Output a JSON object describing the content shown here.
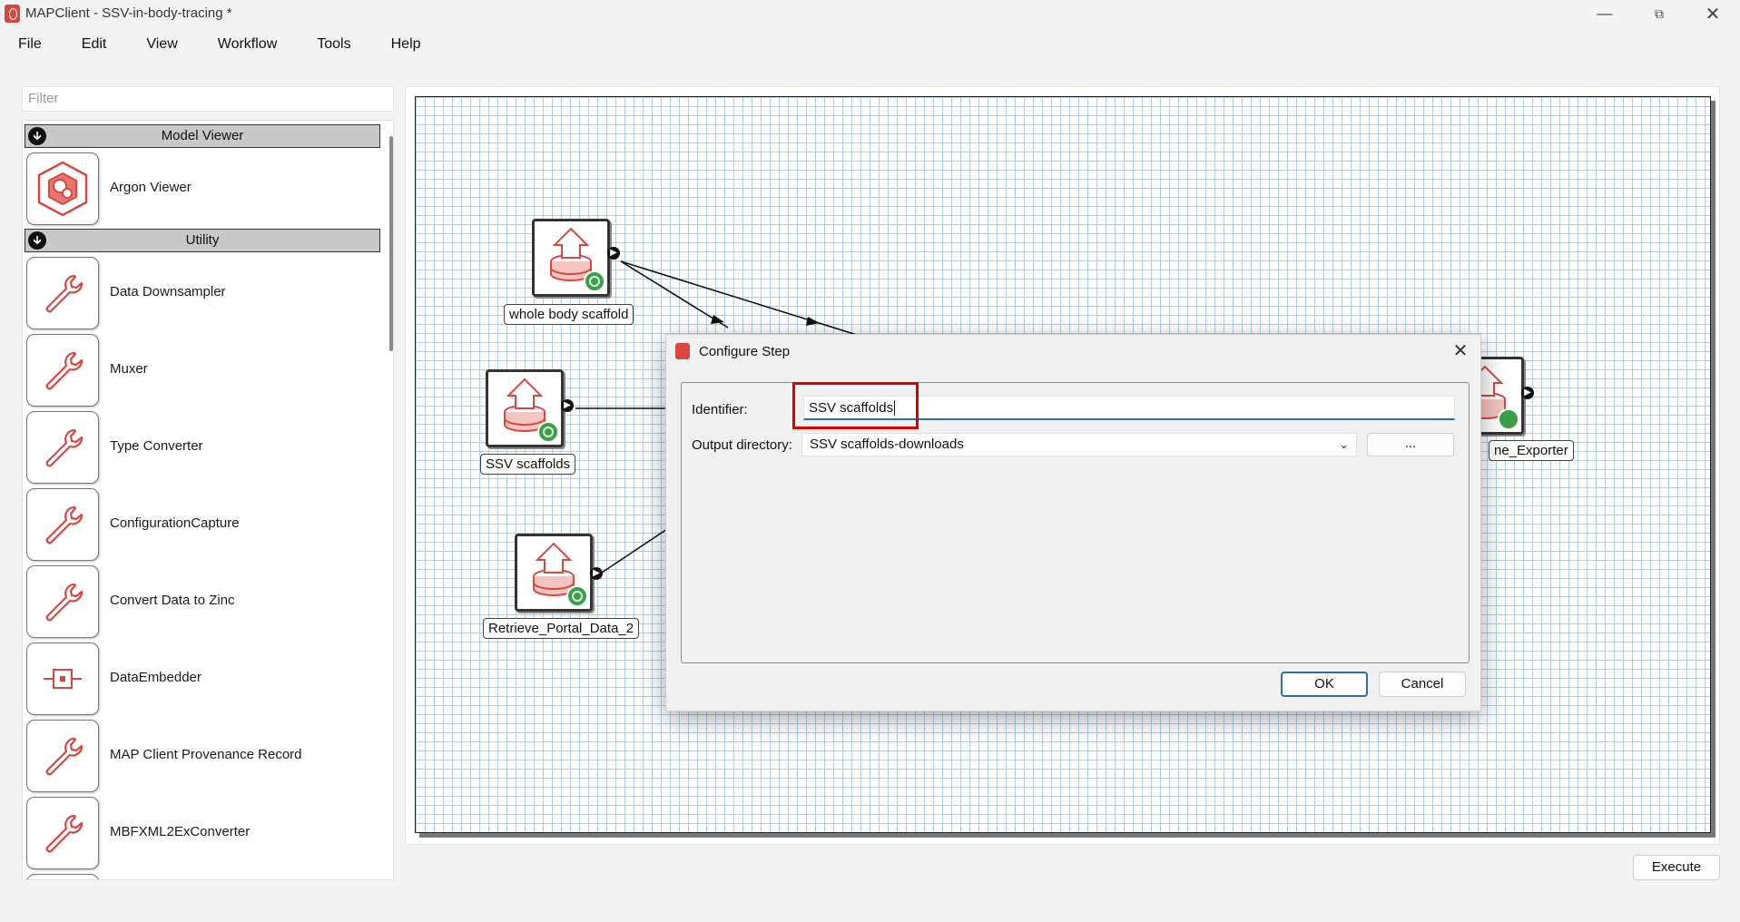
{
  "window": {
    "title": "MAPClient - SSV-in-body-tracing *",
    "minimize_icon": "minimize-icon",
    "maximize_icon": "restore-icon",
    "close_icon": "close-icon"
  },
  "menu": [
    "File",
    "Edit",
    "View",
    "Workflow",
    "Tools",
    "Help"
  ],
  "step_panel": {
    "filter_placeholder": "Filter",
    "categories": [
      {
        "name": "Model Viewer",
        "steps": [
          {
            "label": "Argon Viewer",
            "icon": "argon-viewer-icon"
          }
        ]
      },
      {
        "name": "Utility",
        "steps": [
          {
            "label": "Data Downsampler",
            "icon": "wrench-icon"
          },
          {
            "label": "Muxer",
            "icon": "wrench-icon"
          },
          {
            "label": "Type Converter",
            "icon": "wrench-icon"
          },
          {
            "label": "ConfigurationCapture",
            "icon": "wrench-icon"
          },
          {
            "label": "Convert Data to Zinc",
            "icon": "wrench-icon"
          },
          {
            "label": "DataEmbedder",
            "icon": "embed-icon"
          },
          {
            "label": "MAP Client Provenance Record",
            "icon": "wrench-icon"
          },
          {
            "label": "MBFXML2ExConverter",
            "icon": "wrench-icon"
          }
        ]
      }
    ]
  },
  "workflow": {
    "nodes": [
      {
        "label": "whole body scaffold",
        "icon": "upload-database-icon"
      },
      {
        "label": "SSV scaffolds",
        "icon": "upload-database-icon"
      },
      {
        "label": "Retrieve_Portal_Data_2",
        "icon": "upload-database-icon"
      },
      {
        "label": "ne_Exporter",
        "icon": "upload-database-icon"
      }
    ]
  },
  "dialog": {
    "title": "Configure Step",
    "identifier_label": "Identifier:",
    "identifier_value": "SSV scaffolds",
    "output_dir_label": "Output directory:",
    "output_dir_value": "SSV scaffolds-downloads",
    "browse_label": "...",
    "ok_label": "OK",
    "cancel_label": "Cancel"
  },
  "execute_label": "Execute",
  "colors": {
    "accent_red": "#d9473f",
    "focus_blue": "#2f6fa8",
    "highlight": "#e00000",
    "grid": "#a9cfe0"
  }
}
